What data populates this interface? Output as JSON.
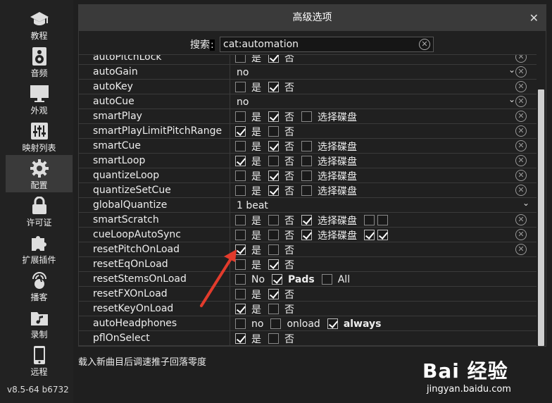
{
  "sidebar": {
    "items": [
      {
        "label": "教程",
        "icon": "graduation-cap-icon"
      },
      {
        "label": "音频",
        "icon": "speaker-icon"
      },
      {
        "label": "外观",
        "icon": "monitor-icon"
      },
      {
        "label": "映射列表",
        "icon": "sliders-icon"
      },
      {
        "label": "配置",
        "icon": "gear-icon"
      },
      {
        "label": "许可证",
        "icon": "lock-icon"
      },
      {
        "label": "扩展插件",
        "icon": "puzzle-icon"
      },
      {
        "label": "播客",
        "icon": "podcast-mic-icon"
      },
      {
        "label": "录制",
        "icon": "music-folder-icon"
      },
      {
        "label": "远程",
        "icon": "phone-icon"
      }
    ],
    "version": "v8.5-64 b6732"
  },
  "dialog": {
    "title": "高级选项",
    "close": "✕",
    "search_label": "搜索",
    "search_colon": ":",
    "search_value": "cat:automation"
  },
  "rows": [
    {
      "name": "autoPitchLock",
      "type": "yesno",
      "yes": false,
      "no": true,
      "reset": true
    },
    {
      "name": "autoGain",
      "type": "select",
      "value": "no",
      "reset": true
    },
    {
      "name": "autoKey",
      "type": "yesno",
      "yes": false,
      "no": true,
      "reset": true
    },
    {
      "name": "autoCue",
      "type": "select",
      "value": "no",
      "reset": true
    },
    {
      "name": "smartPlay",
      "type": "yesno_deck",
      "yes": false,
      "no": true,
      "deck": false,
      "reset": true
    },
    {
      "name": "smartPlayLimitPitchRange",
      "type": "yesno",
      "yes": true,
      "no": false,
      "reset": true
    },
    {
      "name": "smartCue",
      "type": "yesno_deck",
      "yes": false,
      "no": true,
      "deck": false,
      "reset": true
    },
    {
      "name": "smartLoop",
      "type": "yesno_deck",
      "yes": true,
      "no": false,
      "deck": false,
      "reset": true
    },
    {
      "name": "quantizeLoop",
      "type": "yesno_deck",
      "yes": false,
      "no": true,
      "deck": false,
      "reset": true
    },
    {
      "name": "quantizeSetCue",
      "type": "yesno_deck",
      "yes": false,
      "no": true,
      "deck": false,
      "reset": true
    },
    {
      "name": "globalQuantize",
      "type": "select_wide",
      "value": "1 beat",
      "reset": false
    },
    {
      "name": "smartScratch",
      "type": "yesno_deck2",
      "yes": false,
      "no": false,
      "deck": true,
      "d1": false,
      "d2": false,
      "reset": true
    },
    {
      "name": "cueLoopAutoSync",
      "type": "yesno_deck2",
      "yes": false,
      "no": false,
      "deck": true,
      "d1": true,
      "d2": true,
      "reset": true
    },
    {
      "name": "resetPitchOnLoad",
      "type": "yesno",
      "yes": true,
      "no": false,
      "reset": true
    },
    {
      "name": "resetEqOnLoad",
      "type": "yesno",
      "yes": false,
      "no": true,
      "reset": false
    },
    {
      "name": "resetStemsOnLoad",
      "type": "triple",
      "options": [
        {
          "label": "No",
          "on": false,
          "bold": false
        },
        {
          "label": "Pads",
          "on": true,
          "bold": true
        },
        {
          "label": "All",
          "on": false,
          "bold": false
        }
      ],
      "reset": false
    },
    {
      "name": "resetFXOnLoad",
      "type": "yesno",
      "yes": false,
      "no": true,
      "reset": false
    },
    {
      "name": "resetKeyOnLoad",
      "type": "yesno",
      "yes": true,
      "no": false,
      "reset": false
    },
    {
      "name": "autoHeadphones",
      "type": "triple",
      "options": [
        {
          "label": "no",
          "on": false,
          "bold": false
        },
        {
          "label": "onload",
          "on": false,
          "bold": false
        },
        {
          "label": "always",
          "on": true,
          "bold": true
        }
      ],
      "reset": false
    },
    {
      "name": "pflOnSelect",
      "type": "yesno",
      "yes": true,
      "no": false,
      "reset": false
    }
  ],
  "labels": {
    "yes": "是",
    "no": "否",
    "deck": "选择碟盘",
    "reset": "⊗"
  },
  "footnote": "载入新曲目后调速推子回落零度",
  "watermark": {
    "line1": "Bai 经验",
    "line2": "jingyan.baidu.com"
  }
}
